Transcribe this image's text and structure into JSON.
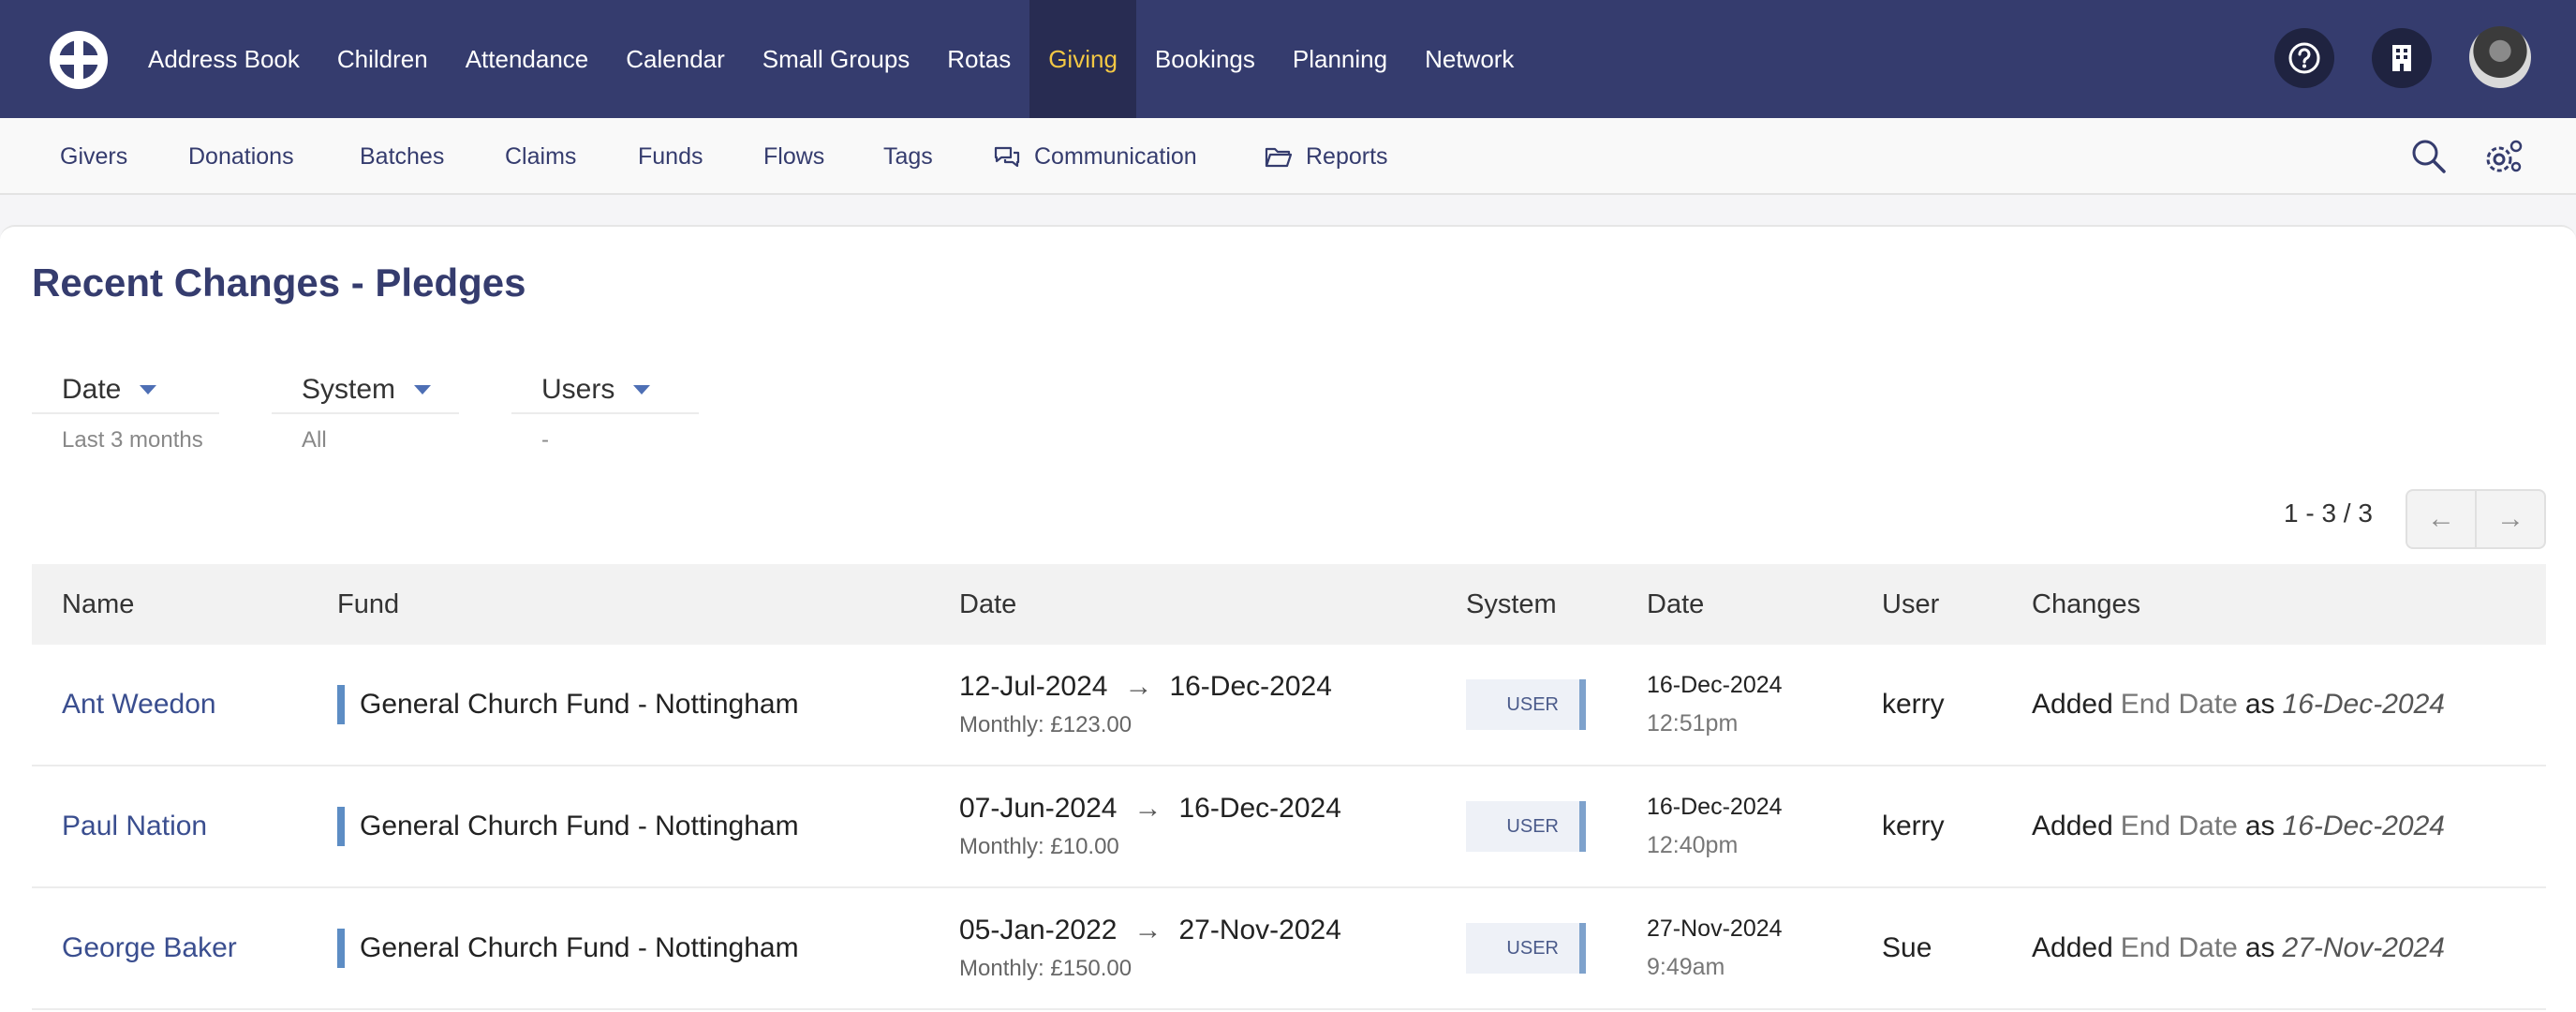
{
  "top_nav": {
    "items": [
      {
        "label": "Address Book"
      },
      {
        "label": "Children"
      },
      {
        "label": "Attendance"
      },
      {
        "label": "Calendar"
      },
      {
        "label": "Small Groups"
      },
      {
        "label": "Rotas"
      },
      {
        "label": "Giving",
        "active": true
      },
      {
        "label": "Bookings"
      },
      {
        "label": "Planning"
      },
      {
        "label": "Network"
      }
    ],
    "active_color": "#f2c744",
    "background": "#353c6e"
  },
  "sub_nav": {
    "items": [
      {
        "label": "Givers"
      },
      {
        "label": "Donations"
      },
      {
        "label": "Batches"
      },
      {
        "label": "Claims"
      },
      {
        "label": "Funds"
      },
      {
        "label": "Flows"
      },
      {
        "label": "Tags"
      },
      {
        "label": "Communication",
        "icon": "chat-icon"
      },
      {
        "label": "Reports",
        "icon": "folder-icon"
      }
    ]
  },
  "page": {
    "title": "Recent Changes - Pledges"
  },
  "filters": [
    {
      "label": "Date",
      "value": "Last 3 months"
    },
    {
      "label": "System",
      "value": "All"
    },
    {
      "label": "Users",
      "value": "-"
    }
  ],
  "pagination": {
    "text": "1 - 3 / 3",
    "prev": "←",
    "next": "→"
  },
  "table": {
    "headers": [
      "Name",
      "Fund",
      "Date",
      "System",
      "Date",
      "User",
      "Changes"
    ],
    "rows": [
      {
        "name": "Ant Weedon",
        "fund": "General Church Fund - Nottingham",
        "start": "12-Jul-2024",
        "end": "16-Dec-2024",
        "monthly": "Monthly: £123.00",
        "system": "USER",
        "date": "16-Dec-2024",
        "time": "12:51pm",
        "user": "kerry",
        "change_action": "Added",
        "change_field": "End Date",
        "change_as": "as",
        "change_value": "16-Dec-2024"
      },
      {
        "name": "Paul Nation",
        "fund": "General Church Fund - Nottingham",
        "start": "07-Jun-2024",
        "end": "16-Dec-2024",
        "monthly": "Monthly: £10.00",
        "system": "USER",
        "date": "16-Dec-2024",
        "time": "12:40pm",
        "user": "kerry",
        "change_action": "Added",
        "change_field": "End Date",
        "change_as": "as",
        "change_value": "16-Dec-2024"
      },
      {
        "name": "George Baker",
        "fund": "General Church Fund - Nottingham",
        "start": "05-Jan-2022",
        "end": "27-Nov-2024",
        "monthly": "Monthly: £150.00",
        "system": "USER",
        "date": "27-Nov-2024",
        "time": "9:49am",
        "user": "Sue",
        "change_action": "Added",
        "change_field": "End Date",
        "change_as": "as",
        "change_value": "27-Nov-2024"
      }
    ]
  }
}
